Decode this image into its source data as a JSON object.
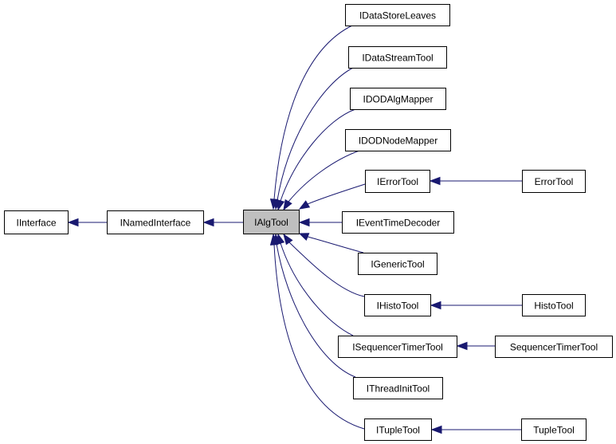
{
  "diagram": {
    "type": "inheritance-graph",
    "edge_color": "#191970",
    "focus_fill": "#bfbfbf",
    "focus_node": "IAlgTool",
    "nodes": [
      {
        "id": "IInterface",
        "label": "IInterface"
      },
      {
        "id": "INamedInterface",
        "label": "INamedInterface"
      },
      {
        "id": "IAlgTool",
        "label": "IAlgTool"
      },
      {
        "id": "IDataStoreLeaves",
        "label": "IDataStoreLeaves"
      },
      {
        "id": "IDataStreamTool",
        "label": "IDataStreamTool"
      },
      {
        "id": "IDODAlgMapper",
        "label": "IDODAlgMapper"
      },
      {
        "id": "IDODNodeMapper",
        "label": "IDODNodeMapper"
      },
      {
        "id": "IErrorTool",
        "label": "IErrorTool"
      },
      {
        "id": "IEventTimeDecoder",
        "label": "IEventTimeDecoder"
      },
      {
        "id": "IGenericTool",
        "label": "IGenericTool"
      },
      {
        "id": "IHistoTool",
        "label": "IHistoTool"
      },
      {
        "id": "ISequencerTimerTool",
        "label": "ISequencerTimerTool"
      },
      {
        "id": "IThreadInitTool",
        "label": "IThreadInitTool"
      },
      {
        "id": "ITupleTool",
        "label": "ITupleTool"
      },
      {
        "id": "ErrorTool",
        "label": "ErrorTool"
      },
      {
        "id": "HistoTool",
        "label": "HistoTool"
      },
      {
        "id": "SequencerTimerTool",
        "label": "SequencerTimerTool"
      },
      {
        "id": "TupleTool",
        "label": "TupleTool"
      }
    ],
    "edges": [
      {
        "from": "INamedInterface",
        "to": "IInterface"
      },
      {
        "from": "IAlgTool",
        "to": "INamedInterface"
      },
      {
        "from": "IDataStoreLeaves",
        "to": "IAlgTool"
      },
      {
        "from": "IDataStreamTool",
        "to": "IAlgTool"
      },
      {
        "from": "IDODAlgMapper",
        "to": "IAlgTool"
      },
      {
        "from": "IDODNodeMapper",
        "to": "IAlgTool"
      },
      {
        "from": "IErrorTool",
        "to": "IAlgTool"
      },
      {
        "from": "IEventTimeDecoder",
        "to": "IAlgTool"
      },
      {
        "from": "IGenericTool",
        "to": "IAlgTool"
      },
      {
        "from": "IHistoTool",
        "to": "IAlgTool"
      },
      {
        "from": "ISequencerTimerTool",
        "to": "IAlgTool"
      },
      {
        "from": "IThreadInitTool",
        "to": "IAlgTool"
      },
      {
        "from": "ITupleTool",
        "to": "IAlgTool"
      },
      {
        "from": "ErrorTool",
        "to": "IErrorTool"
      },
      {
        "from": "HistoTool",
        "to": "IHistoTool"
      },
      {
        "from": "SequencerTimerTool",
        "to": "ISequencerTimerTool"
      },
      {
        "from": "TupleTool",
        "to": "ITupleTool"
      }
    ]
  }
}
